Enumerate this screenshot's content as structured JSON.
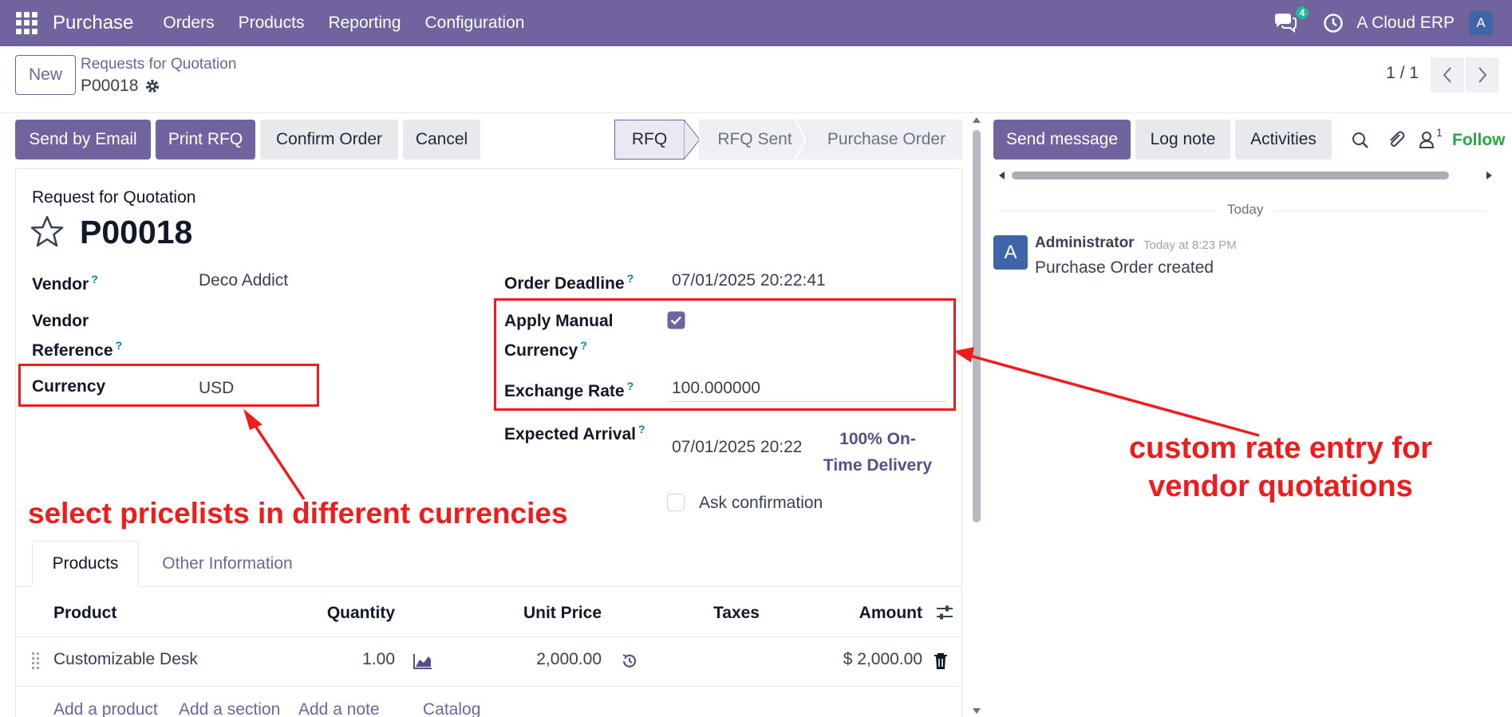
{
  "topbar": {
    "app_name": "Purchase",
    "menu": [
      "Orders",
      "Products",
      "Reporting",
      "Configuration"
    ],
    "chat_badge": "4",
    "company": "A Cloud ERP",
    "avatar": "A"
  },
  "control_panel": {
    "new_label": "New",
    "breadcrumb_parent": "Requests for Quotation",
    "breadcrumb_current": "P00018",
    "pager": "1 / 1"
  },
  "actions": {
    "send_email": "Send by Email",
    "print_rfq": "Print RFQ",
    "confirm_order": "Confirm Order",
    "cancel": "Cancel"
  },
  "status": {
    "stages": [
      "RFQ",
      "RFQ Sent",
      "Purchase Order"
    ],
    "active": "RFQ"
  },
  "form": {
    "subtitle": "Request for Quotation",
    "name": "P00018",
    "vendor_label": "Vendor",
    "vendor_value": "Deco Addict",
    "vendor_ref_label_1": "Vendor",
    "vendor_ref_label_2": "Reference",
    "currency_label": "Currency",
    "currency_value": "USD",
    "order_deadline_label": "Order Deadline",
    "order_deadline_value": "07/01/2025 20:22:41",
    "apply_manual_label_1": "Apply Manual",
    "apply_manual_label_2": "Currency",
    "exchange_rate_label": "Exchange Rate",
    "exchange_rate_value": "100.000000",
    "expected_arrival_label": "Expected Arrival",
    "expected_arrival_value": "07/01/2025 20:22",
    "ontime_line1": "100% On-",
    "ontime_line2": "Time Delivery",
    "ask_confirmation": "Ask confirmation",
    "help_mark": "?"
  },
  "tabs": [
    "Products",
    "Other Information"
  ],
  "table": {
    "headers": [
      "Product",
      "Quantity",
      "Unit Price",
      "Taxes",
      "Amount"
    ],
    "rows": [
      {
        "product": "Customizable Desk",
        "quantity": "1.00",
        "unit_price": "2,000.00",
        "taxes": "",
        "amount": "$ 2,000.00"
      }
    ],
    "add_links": [
      "Add a product",
      "Add a section",
      "Add a note",
      "Catalog"
    ]
  },
  "chatter": {
    "send_message": "Send message",
    "log_note": "Log note",
    "activities": "Activities",
    "follower_count": "1",
    "follow": "Follow",
    "date_separator": "Today",
    "message_author": "Administrator",
    "message_time": "Today at 8:23 PM",
    "message_body": "Purchase Order created",
    "message_avatar": "A"
  },
  "annotations": {
    "left_text": "select pricelists in different currencies",
    "right_line1": "custom rate entry for",
    "right_line2": "vendor quotations"
  },
  "colors": {
    "brand": "#71639e",
    "annotation": "#ee1c1c",
    "help": "#0180a5",
    "follow": "#28a745"
  }
}
